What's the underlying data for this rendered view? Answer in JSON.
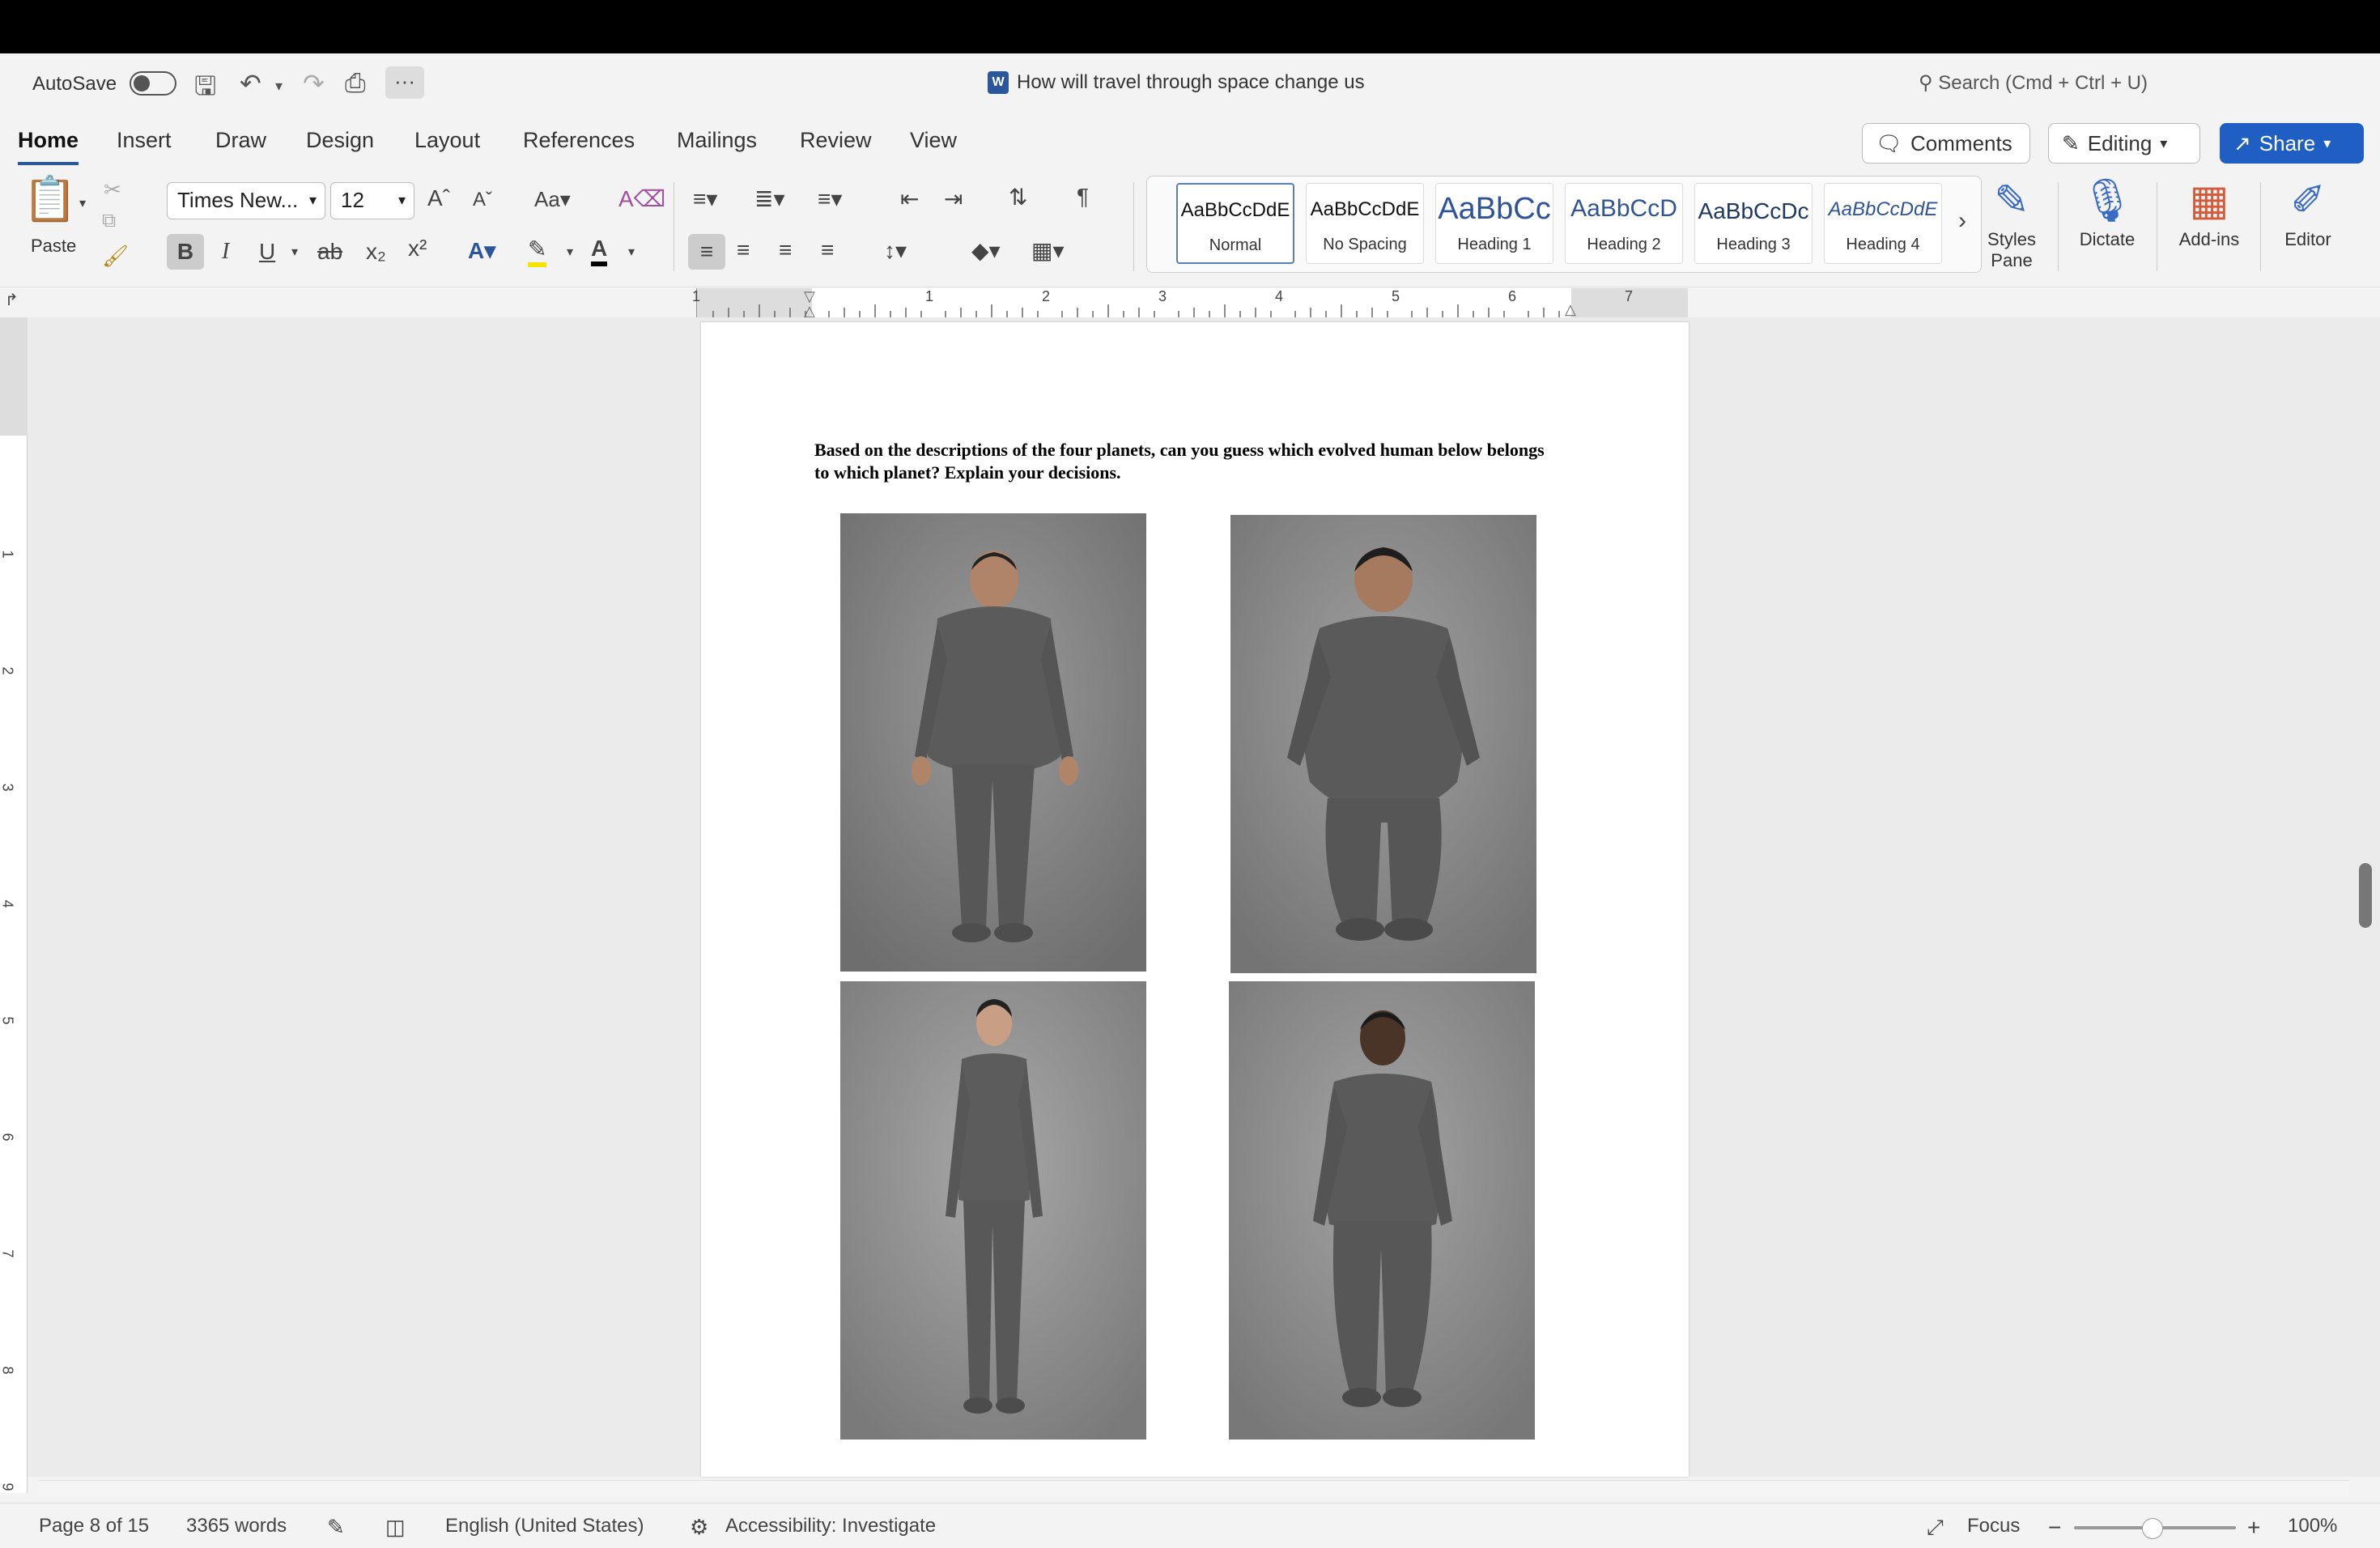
{
  "app": {
    "autosave_label": "AutoSave",
    "document_title": "How will travel through space change us",
    "search_placeholder": "Search (Cmd + Ctrl + U)"
  },
  "tabs": [
    {
      "label": "Home"
    },
    {
      "label": "Insert"
    },
    {
      "label": "Draw"
    },
    {
      "label": "Design"
    },
    {
      "label": "Layout"
    },
    {
      "label": "References"
    },
    {
      "label": "Mailings"
    },
    {
      "label": "Review"
    },
    {
      "label": "View"
    }
  ],
  "header_buttons": {
    "comments": "Comments",
    "editing": "Editing",
    "share": "Share"
  },
  "ribbon": {
    "paste_label": "Paste",
    "font_name": "Times New...",
    "font_size": "12",
    "styles": [
      {
        "sample": "AaBbCcDdE",
        "name": "Normal"
      },
      {
        "sample": "AaBbCcDdE",
        "name": "No Spacing"
      },
      {
        "sample": "AaBbCc",
        "name": "Heading 1"
      },
      {
        "sample": "AaBbCcD",
        "name": "Heading 2"
      },
      {
        "sample": "AaBbCcDc",
        "name": "Heading 3"
      },
      {
        "sample": "AaBbCcDdE",
        "name": "Heading 4"
      }
    ],
    "styles_pane": "Styles Pane",
    "dictate": "Dictate",
    "addins": "Add-ins",
    "editor": "Editor"
  },
  "ruler": {
    "marks": [
      "1",
      "1",
      "2",
      "3",
      "4",
      "5",
      "6",
      "7"
    ],
    "vmarks": [
      "1",
      "2",
      "3",
      "4",
      "5",
      "6",
      "7",
      "8",
      "9"
    ]
  },
  "document": {
    "paragraph": "Based on the descriptions of the four planets, can you guess which evolved human below belongs to which planet? Explain your decisions."
  },
  "status": {
    "page": "Page 8 of 15",
    "words": "3365 words",
    "language": "English (United States)",
    "accessibility": "Accessibility: Investigate",
    "focus": "Focus",
    "zoom": "100%"
  },
  "colors": {
    "accent": "#2b579a",
    "share": "#1f5fc4"
  }
}
